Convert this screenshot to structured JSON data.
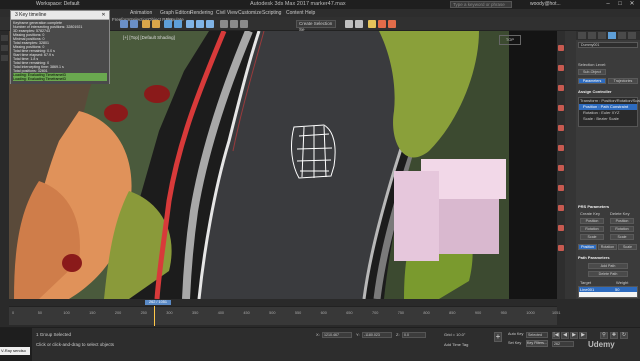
{
  "titlebar": {
    "app_menu": "Workspace: Default",
    "title": "Autodesk 3ds Max 2017    marker47.max",
    "search_placeholder": "Type a keyword or phrase",
    "user": "woody@hot...",
    "minimize": "–",
    "maximize": "□",
    "close": "✕"
  },
  "menubar": {
    "items": [
      "Animation",
      "Graph Editors",
      "Rendering",
      "Civil View",
      "Customize",
      "Scripting",
      "Content",
      "Help"
    ],
    "sub": [
      "Freeform",
      "Selection",
      "Object Paint",
      "Populate"
    ]
  },
  "toolbar": {
    "selection_set": "Create Selection Se"
  },
  "viewport": {
    "label": "[+] [Top] [Default Shading]",
    "nav_cube": "TOP"
  },
  "script_window": {
    "title": "3 Key timeline",
    "close": "✕",
    "lines": [
      "Keyframe generation complete",
      "Number of intersecting positions: 32801921",
      "3D examples: 5782743",
      "Missing positions: 0",
      "Minimal positions: 0",
      "Total examples: 32801",
      "Missing positions: 0",
      "Total time remaining: 0.0 s",
      "Start time elapsed: 67.9 s",
      "Total time: 1.8 s",
      "Total time remaining: 0",
      "Total intercepting time: 3869.1 s",
      "Total positions: 32801",
      "Loading: Evaluating TimeframeID",
      "Loading: Evaluating TimeframeID"
    ]
  },
  "right_panel": {
    "tab_name": "Dummy001",
    "selection_level_label": "Selection Level:",
    "sub_object": "Sub-Object",
    "parameters_btn": "Parameters",
    "trajectories_btn": "Trajectories",
    "assign_controller": "Assign Controller",
    "controller_items": [
      "Transform : Position/Rotation/Scale",
      "Position : Path Constraint",
      "Rotation : Euler XYZ",
      "Scale : Bezier Scale"
    ],
    "prs_header": "PRS Parameters",
    "create_key": "Create Key",
    "delete_key": "Delete Key",
    "position_btn": "Position",
    "rotation_btn": "Rotation",
    "scale_btn": "Scale",
    "bottom_tabs": [
      "Position",
      "Rotation",
      "Scale"
    ],
    "path_params_header": "Path Parameters",
    "add_path": "Add Path",
    "delete_path": "Delete Path",
    "target_col": "Target",
    "weight_col": "Weight",
    "path_item": "Line001",
    "path_weight": "50"
  },
  "timeline": {
    "slider_label": "262 / 1051",
    "ticks": [
      "0",
      "50",
      "100",
      "150",
      "200",
      "250",
      "300",
      "350",
      "400",
      "450",
      "500",
      "550",
      "600",
      "650",
      "700",
      "750",
      "800",
      "850",
      "900",
      "950",
      "1000",
      "1051"
    ]
  },
  "status": {
    "maxscript_tag": "V-Ray sendso",
    "selected": "1 Group Selected",
    "prompt": "Click or click-and-drag to select objects",
    "x_label": "X:",
    "x_val": "1210.467",
    "y_label": "Y:",
    "y_val": "-1180.023",
    "z_label": "Z:",
    "z_val": "0.0",
    "grid": "Grid = 10.0\"",
    "add_time_tag": "Add Time Tag",
    "auto_key": "Auto Key",
    "set_key": "Set Key",
    "selected_dd": "Selected",
    "key_filters": "Key Filters...",
    "frame": "262",
    "udemy": "Udemy"
  }
}
